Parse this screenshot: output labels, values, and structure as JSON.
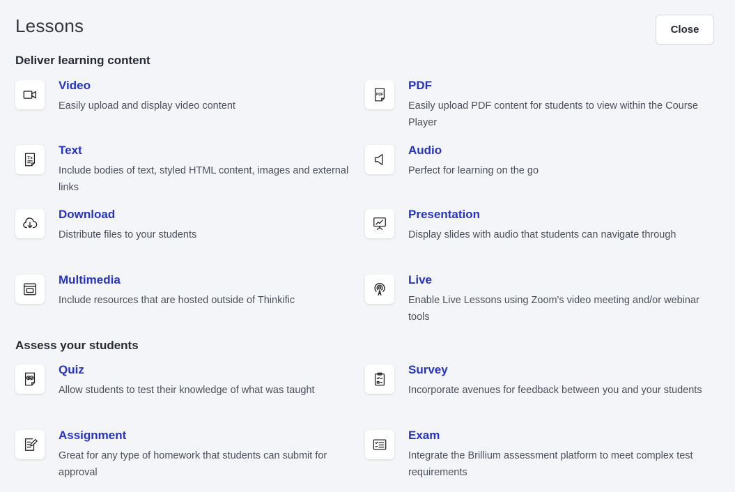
{
  "header": {
    "title": "Lessons",
    "close_label": "Close"
  },
  "sections": [
    {
      "title": "Deliver learning content"
    },
    {
      "title": "Assess your students"
    }
  ],
  "lessons": [
    {
      "title": "Video",
      "description": "Easily upload and display video content",
      "icon": "video-icon"
    },
    {
      "title": "PDF",
      "description": "Easily upload PDF content for students to view within the Course Player",
      "icon": "pdf-icon"
    },
    {
      "title": "Text",
      "description": "Include bodies of text, styled HTML content, images and external links",
      "icon": "text-icon"
    },
    {
      "title": "Audio",
      "description": "Perfect for learning on the go",
      "icon": "audio-icon"
    },
    {
      "title": "Download",
      "description": "Distribute files to your students",
      "icon": "cloud-download-icon"
    },
    {
      "title": "Presentation",
      "description": "Display slides with audio that students can navigate through",
      "icon": "presentation-icon"
    },
    {
      "title": "Multimedia",
      "description": "Include resources that are hosted outside of Thinkific",
      "icon": "multimedia-icon"
    },
    {
      "title": "Live",
      "description": "Enable Live Lessons using Zoom's video meeting and/or webinar tools",
      "icon": "live-broadcast-icon"
    }
  ],
  "assessments": [
    {
      "title": "Quiz",
      "description": "Allow students to test their knowledge of what was taught",
      "icon": "quiz-icon"
    },
    {
      "title": "Survey",
      "description": "Incorporate avenues for feedback between you and your students",
      "icon": "survey-clipboard-icon"
    },
    {
      "title": "Assignment",
      "description": "Great for any type of homework that students can submit for approval",
      "icon": "assignment-icon"
    },
    {
      "title": "Exam",
      "description": "Integrate the Brillium assessment platform to meet complex test requirements",
      "icon": "exam-icon"
    }
  ],
  "colors": {
    "background": "#f4f5f8",
    "item_title": "#2633c4",
    "description": "#4a4f5c",
    "heading": "#262a33"
  }
}
